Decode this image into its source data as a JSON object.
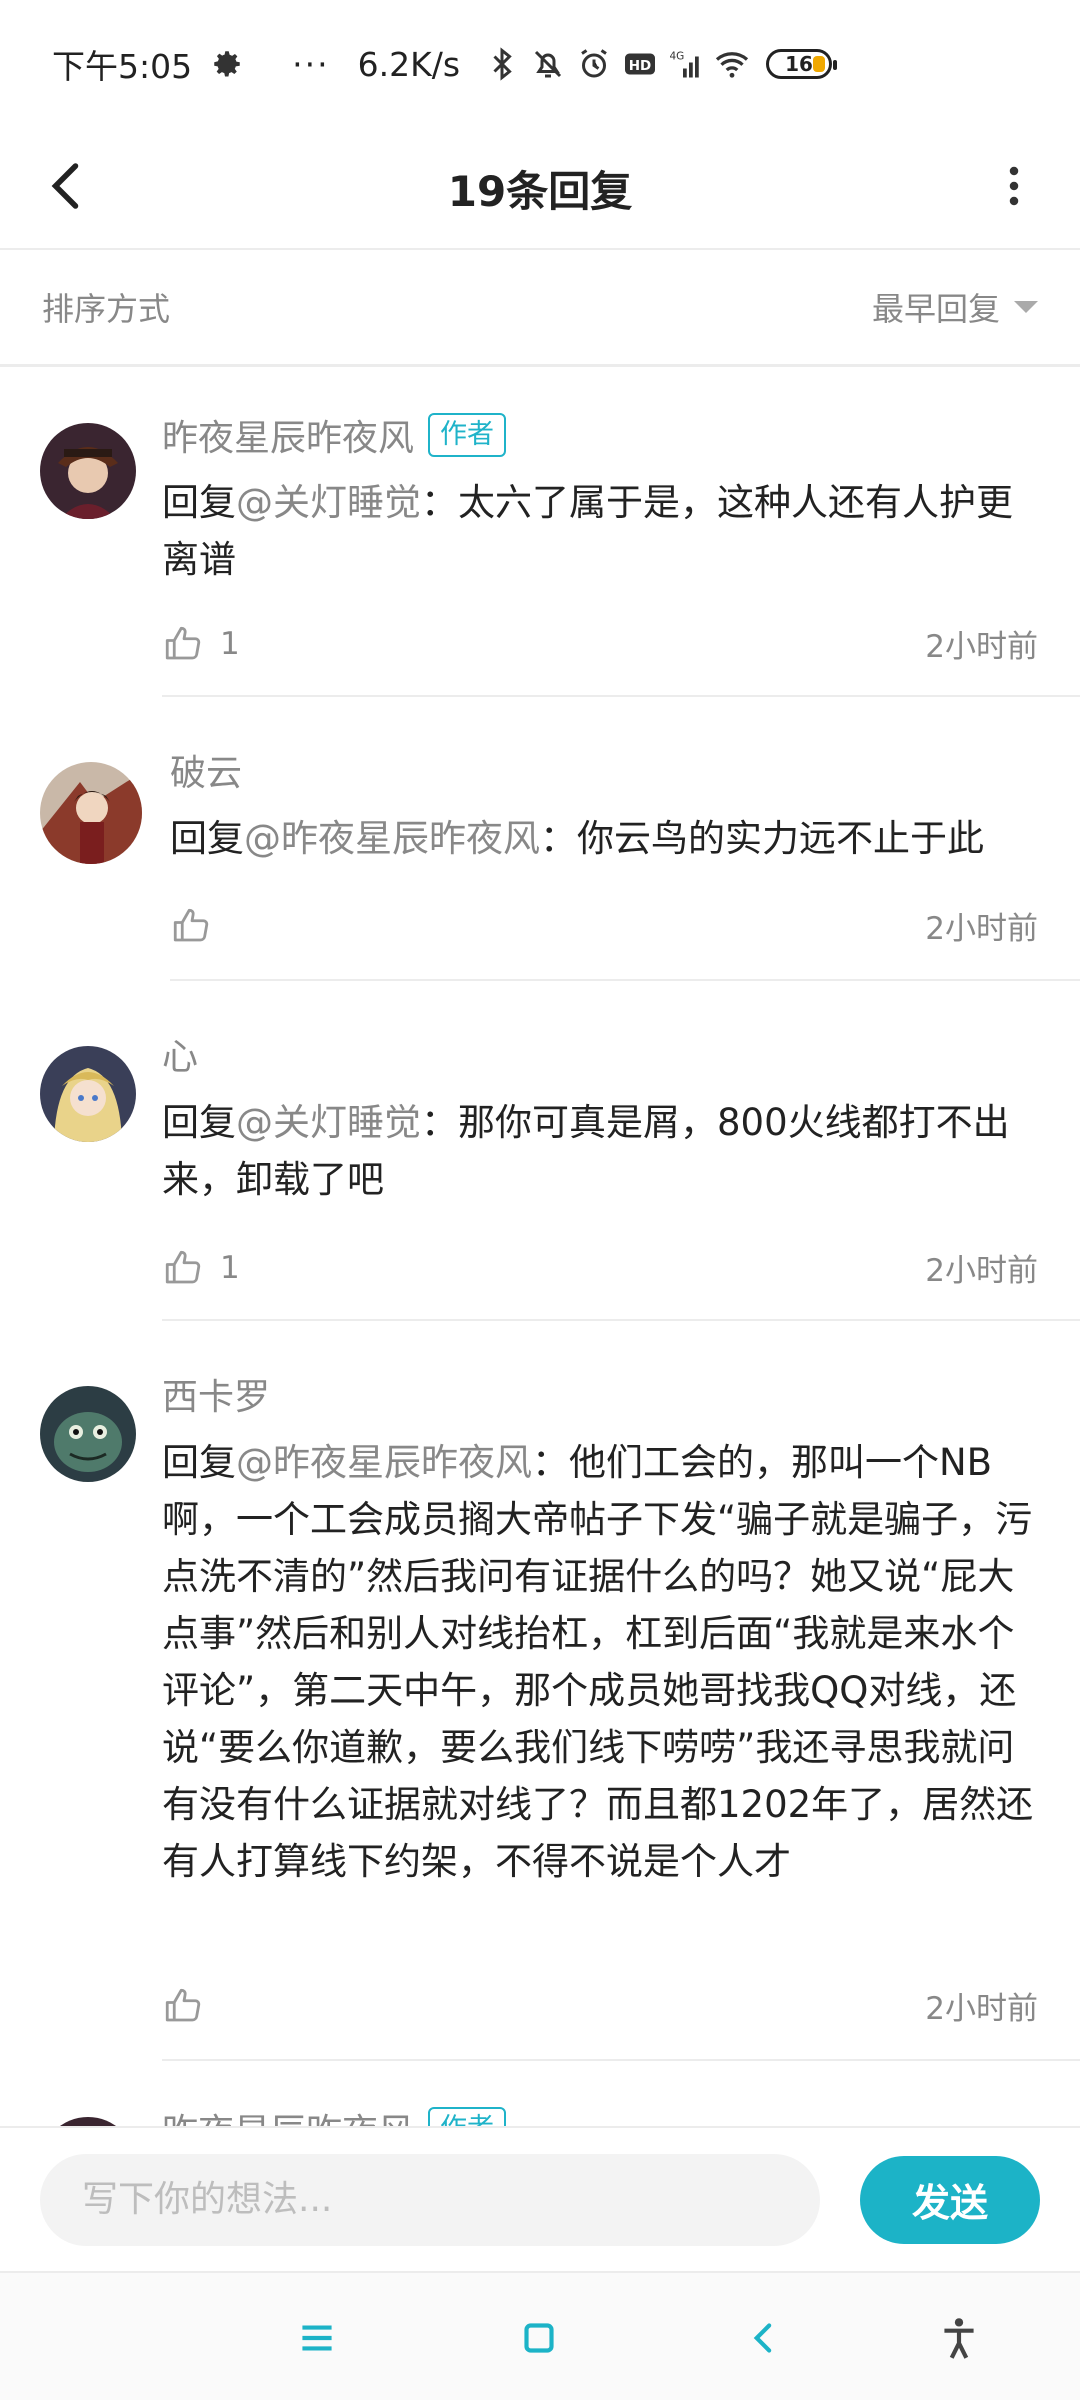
{
  "status_bar": {
    "time": "下午5:05",
    "more_dots": "···",
    "net_speed": "6.2K/s",
    "battery": "16",
    "icons": [
      "gear-icon",
      "bluetooth-icon",
      "mute-icon",
      "alarm-icon",
      "hd-icon",
      "signal-4g-icon",
      "wifi-icon",
      "battery-icon"
    ]
  },
  "header": {
    "title": "19条回复",
    "back_icon": "back-chevron-icon",
    "more_icon": "more-vertical-icon"
  },
  "sort": {
    "label": "排序方式",
    "value": "最早回复"
  },
  "replies": [
    {
      "username": "昨夜星辰昨夜风",
      "badge": "作者",
      "reply_prefix": "回复",
      "mention": "@关灯睡觉",
      "text": "：太六了属于是，这种人还有人护更离谱",
      "likes": "1",
      "time": "2小时前"
    },
    {
      "username": "破云",
      "badge": "",
      "reply_prefix": "回复",
      "mention": "@昨夜星辰昨夜风",
      "text": "：你云鸟的实力远不止于此",
      "likes": "",
      "time": "2小时前"
    },
    {
      "username": "心",
      "badge": "",
      "reply_prefix": "回复",
      "mention": "@关灯睡觉",
      "text": "：那你可真是屑，800火线都打不出来，卸载了吧",
      "likes": "1",
      "time": "2小时前"
    },
    {
      "username": "西卡罗",
      "badge": "",
      "reply_prefix": "回复",
      "mention": "@昨夜星辰昨夜风",
      "text": "：他们工会的，那叫一个NB啊，一个工会成员搁大帝帖子下发“骗子就是骗子，污点洗不清的”然后我问有证据什么的吗？她又说“屁大点事”然后和别人对线抬杠，杠到后面“我就是来水个评论”，第二天中午，那个成员她哥找我QQ对线，还说“要么你道歉，要么我们线下唠唠”我还寻思我就问有没有什么证据就对线了？而且都1202年了，居然还有人打算线下约架，不得不说是个人才",
      "likes": "",
      "time": "2小时前"
    },
    {
      "username": "昨夜星辰昨夜风",
      "badge": "作者",
      "reply_prefix": "",
      "mention": "",
      "text": "",
      "likes": "",
      "time": ""
    }
  ],
  "input": {
    "placeholder": "写下你的想法...",
    "send_label": "发送"
  },
  "colors": {
    "accent": "#1cb3c7",
    "muted_text": "#888888",
    "body_text": "#222222",
    "divider": "#ececec"
  },
  "nav": [
    "menu-icon",
    "home-square-icon",
    "back-icon",
    "accessibility-icon"
  ]
}
